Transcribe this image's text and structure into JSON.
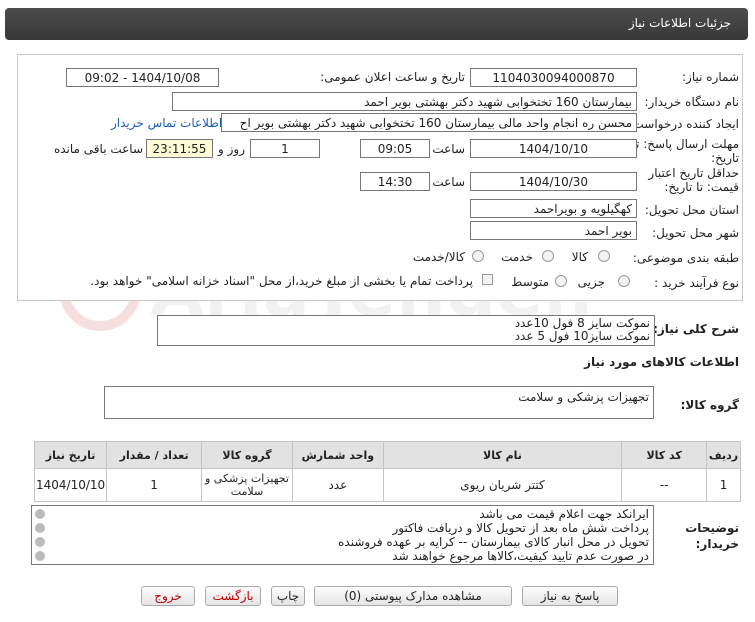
{
  "header": {
    "title": "جزئیات اطلاعات نیاز"
  },
  "form": {
    "need_number_label": "شماره نیاز:",
    "need_number": "1104030094000870",
    "announce_label": "تاریخ و ساعت اعلان عمومی:",
    "announce_value": "1404/10/08 - 09:02",
    "buyer_label": "نام دستگاه خریدار:",
    "buyer_value": "بیمارستان 160 تختخوابی شهید دکتر بهشتی بویر احمد",
    "requester_label": "ایجاد کننده درخواست:",
    "requester_value": "محسن ره انجام واحد مالی بیمارستان 160 تختخوابی شهید دکتر بهشتی بویر اح",
    "contact_link": "اطلاعات تماس خریدار",
    "deadline_label": "مهلت ارسال پاسخ: تا",
    "deadline_label2": "تاریخ:",
    "deadline_date": "1404/10/10",
    "time_label": "ساعت",
    "deadline_time": "09:05",
    "days_value": "1",
    "days_label": "روز و",
    "remaining_time": "23:11:55",
    "remaining_label": "ساعت باقی مانده",
    "validity_label": "حداقل تاریخ اعتبار",
    "validity_label2": "قیمت: تا تاریخ:",
    "validity_date": "1404/10/30",
    "validity_time": "14:30",
    "province_label": "استان محل تحویل:",
    "province_value": "کهگیلویه و بویراحمد",
    "city_label": "شهر محل تحویل:",
    "city_value": "بویر احمد",
    "category_label": "طبقه بندی موضوعی:",
    "category_options": [
      "کالا",
      "خدمت",
      "کالا/خدمت"
    ],
    "process_label": "نوع فرآیند خرید :",
    "process_options": [
      "جزیی",
      "متوسط"
    ],
    "payment_note": "پرداخت تمام یا بخشی از مبلغ خرید،از محل \"اسناد خزانه اسلامی\" خواهد بود."
  },
  "description": {
    "label": "شرح کلی نیاز:",
    "lines": [
      "نموکت سایز 8 فول 10عدد",
      "نموکت سایز10 فول 5 عدد"
    ]
  },
  "goods_info": {
    "title": "اطلاعات کالاهای مورد نیاز",
    "group_label": "گروه کالا:",
    "group_value": "تجهیزات پزشکی و سلامت"
  },
  "table": {
    "headers": [
      "ردیف",
      "کد کالا",
      "نام کالا",
      "واحد شمارش",
      "گروه کالا",
      "تعداد / مقدار",
      "تاریخ نیاز"
    ],
    "rows": [
      [
        "1",
        "--",
        "کتتر شریان ریوی",
        "عدد",
        "تجهیزات پزشکی و سلامت",
        "1",
        "1404/10/10"
      ]
    ]
  },
  "notes": {
    "label": "توضیحات",
    "label2": "خریدار:",
    "lines": [
      "ایرانکد جهت اعلام قیمت می باشد",
      "پرداخت شش ماه بعد از تحویل کالا و دریافت فاکتور",
      "تحویل در محل انبار کالای بیمارستان -- کرایه بر عهده فروشنده",
      "در صورت عدم تایید کیفیت،کالاها مرجوع خواهند شد"
    ]
  },
  "buttons": {
    "reply": "پاسخ به نیاز",
    "attachments": "مشاهده مدارک پیوستی (0)",
    "print": "چاپ",
    "back": "بازگشت",
    "exit": "خروج"
  },
  "watermark": "AriaTender.net",
  "colors": {
    "header_bg": "#3f3f3f",
    "link": "#1a5fb4",
    "time_bg": "#fffbd6",
    "exit_text": "#c00000"
  }
}
